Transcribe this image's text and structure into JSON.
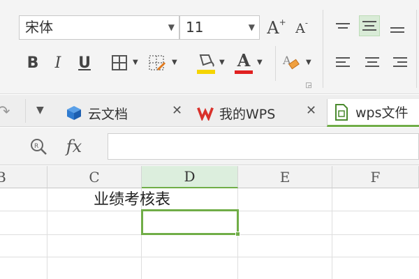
{
  "ribbon": {
    "font_name": "宋体",
    "font_size": "11",
    "grow_font_label": "A",
    "shrink_font_label": "A",
    "bold_label": "B",
    "italic_label": "I",
    "underline_label": "U",
    "font_color_label": "A",
    "font_color": "#e02020",
    "fill_color": "#f5d400"
  },
  "tabs": [
    {
      "label": "云文档",
      "icon": "cloud-cube-icon"
    },
    {
      "label": "我的WPS",
      "icon": "wps-logo-icon"
    },
    {
      "label": "wps文件",
      "icon": "spreadsheet-file-icon"
    }
  ],
  "formula_bar": {
    "fx_label": "fx",
    "value": ""
  },
  "sheet": {
    "columns": [
      "B",
      "C",
      "D",
      "E",
      "F"
    ],
    "selected_column": "D",
    "title_cell": "业绩考核表",
    "accent": "#70ad47"
  }
}
